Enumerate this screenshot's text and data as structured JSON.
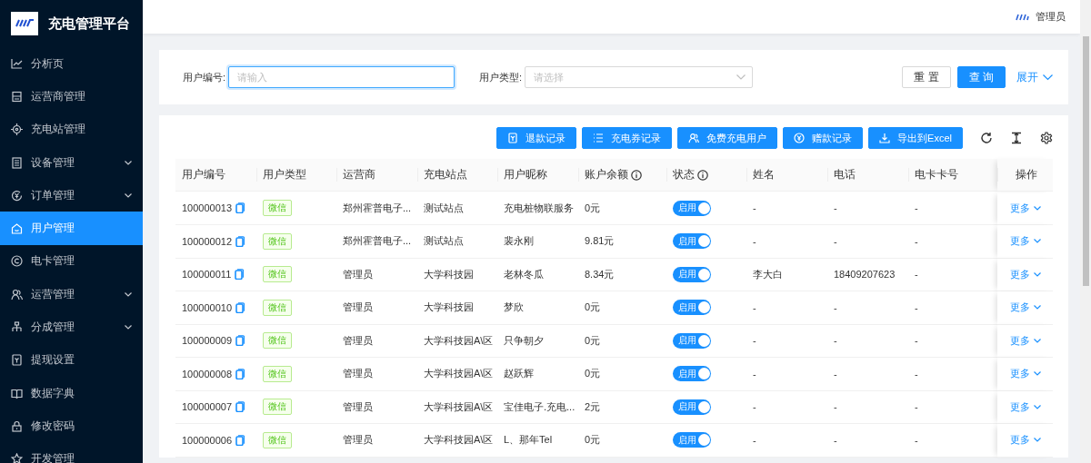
{
  "app_title": "充电管理平台",
  "sidebar": {
    "items": [
      {
        "label": "分析页",
        "selected": false,
        "submenu": false
      },
      {
        "label": "运营商管理",
        "selected": false,
        "submenu": false
      },
      {
        "label": "充电站管理",
        "selected": false,
        "submenu": false
      },
      {
        "label": "设备管理",
        "selected": false,
        "submenu": true
      },
      {
        "label": "订单管理",
        "selected": false,
        "submenu": true
      },
      {
        "label": "用户管理",
        "selected": true,
        "submenu": false
      },
      {
        "label": "电卡管理",
        "selected": false,
        "submenu": false
      },
      {
        "label": "运营管理",
        "selected": false,
        "submenu": true
      },
      {
        "label": "分成管理",
        "selected": false,
        "submenu": true
      },
      {
        "label": "提现设置",
        "selected": false,
        "submenu": false
      },
      {
        "label": "数据字典",
        "selected": false,
        "submenu": false
      },
      {
        "label": "修改密码",
        "selected": false,
        "submenu": false
      },
      {
        "label": "开发管理",
        "selected": false,
        "submenu": false
      }
    ]
  },
  "header": {
    "user": "管理员"
  },
  "search": {
    "fields": [
      {
        "kind": "input",
        "label": "用户编号:",
        "placeholder": "请输入",
        "focused": true
      },
      {
        "kind": "select",
        "label": "用户类型:",
        "placeholder": "请选择",
        "focused": false
      }
    ],
    "reset": "重 置",
    "query": "查 询",
    "expand": "展开"
  },
  "toolbar": {
    "buttons": [
      "退款记录",
      "充电券记录",
      "免费充电用户",
      "赠款记录",
      "导出到Excel"
    ]
  },
  "table": {
    "columns": [
      {
        "label": "用户编号",
        "info": false
      },
      {
        "label": "用户类型",
        "info": false
      },
      {
        "label": "运营商",
        "info": false
      },
      {
        "label": "充电站点",
        "info": false
      },
      {
        "label": "用户昵称",
        "info": false
      },
      {
        "label": "账户余额",
        "info": true
      },
      {
        "label": "状态",
        "info": true
      },
      {
        "label": "姓名",
        "info": false
      },
      {
        "label": "电话",
        "info": false
      },
      {
        "label": "电卡卡号",
        "info": false
      },
      {
        "label": "操作",
        "info": false
      }
    ],
    "rows": [
      {
        "user_id": "100000013",
        "type": "微信",
        "operator": "郑州霍普电子...",
        "station": "测试站点",
        "nickname": "充电桩物联服务",
        "balance": "0元",
        "status": {
          "label": "启用",
          "on": true
        },
        "name": "-",
        "phone": "-",
        "card": "-",
        "action": "更多"
      },
      {
        "user_id": "100000012",
        "type": "微信",
        "operator": "郑州霍普电子...",
        "station": "测试站点",
        "nickname": "裴永刚",
        "balance": "9.81元",
        "status": {
          "label": "启用",
          "on": true
        },
        "name": "-",
        "phone": "-",
        "card": "-",
        "action": "更多"
      },
      {
        "user_id": "100000011",
        "type": "微信",
        "operator": "管理员",
        "station": "大学科技园",
        "nickname": "老林冬瓜",
        "balance": "8.34元",
        "status": {
          "label": "启用",
          "on": true
        },
        "name": "李大白",
        "phone": "18409207623",
        "card": "-",
        "action": "更多"
      },
      {
        "user_id": "100000010",
        "type": "微信",
        "operator": "管理员",
        "station": "大学科技园",
        "nickname": "梦欣",
        "balance": "0元",
        "status": {
          "label": "启用",
          "on": true
        },
        "name": "-",
        "phone": "-",
        "card": "-",
        "action": "更多"
      },
      {
        "user_id": "100000009",
        "type": "微信",
        "operator": "管理员",
        "station": "大学科技园A\\区",
        "nickname": "只争朝夕",
        "balance": "0元",
        "status": {
          "label": "启用",
          "on": true
        },
        "name": "-",
        "phone": "-",
        "card": "-",
        "action": "更多"
      },
      {
        "user_id": "100000008",
        "type": "微信",
        "operator": "管理员",
        "station": "大学科技园A\\区",
        "nickname": "赵跃辉",
        "balance": "0元",
        "status": {
          "label": "启用",
          "on": true
        },
        "name": "-",
        "phone": "-",
        "card": "-",
        "action": "更多"
      },
      {
        "user_id": "100000007",
        "type": "微信",
        "operator": "管理员",
        "station": "大学科技园A\\区",
        "nickname": "宝佳电子.充电...",
        "balance": "2元",
        "status": {
          "label": "启用",
          "on": true
        },
        "name": "-",
        "phone": "-",
        "card": "-",
        "action": "更多"
      },
      {
        "user_id": "100000006",
        "type": "微信",
        "operator": "管理员",
        "station": "大学科技园A\\区",
        "nickname": "L、那年Tel",
        "balance": "0元",
        "status": {
          "label": "启用",
          "on": true
        },
        "name": "-",
        "phone": "-",
        "card": "-",
        "action": "更多"
      }
    ]
  }
}
